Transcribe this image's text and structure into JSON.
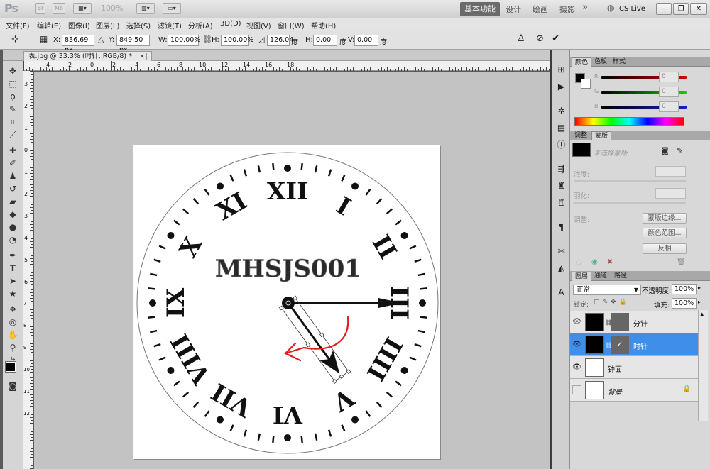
{
  "app": {
    "logo": "Ps",
    "zoom_level": "100%",
    "workspaces": [
      "基本功能",
      "设计",
      "绘画",
      "摄影"
    ],
    "more_workspaces": "»",
    "cs_live": "CS Live"
  },
  "menu": [
    "文件(F)",
    "编辑(E)",
    "图像(I)",
    "图层(L)",
    "选择(S)",
    "滤镜(T)",
    "分析(A)",
    "3D(D)",
    "视图(V)",
    "窗口(W)",
    "帮助(H)"
  ],
  "options": {
    "x_label": "X:",
    "x_value": "836.69 px",
    "y_label": "Y:",
    "y_value": "849.50 px",
    "w_label": "W:",
    "w_value": "100.00%",
    "h_label": "H:",
    "h_value": "100.00%",
    "rot_value": "126.04",
    "deg": "度",
    "hskew_label": "H:",
    "hskew_value": "0.00",
    "vskew_label": "V:",
    "vskew_value": "0.00"
  },
  "document": {
    "tab_title": "表.jpg @ 33.3% (时针, RGB/8) *",
    "clock_text": "MHSJS001"
  },
  "ruler": {
    "top": [
      "4",
      "2",
      "0",
      "2",
      "4",
      "6",
      "8",
      "10",
      "12",
      "14",
      "16",
      "18"
    ],
    "left": [
      "3",
      "2",
      "1",
      "0",
      "1",
      "2",
      "3",
      "4",
      "5",
      "6",
      "7",
      "8",
      "9",
      "10",
      "11",
      "12"
    ]
  },
  "color_panel": {
    "tabs": [
      "颜色",
      "色板",
      "样式"
    ],
    "channels": [
      {
        "label": "R",
        "value": "0"
      },
      {
        "label": "G",
        "value": "0"
      },
      {
        "label": "B",
        "value": "0"
      }
    ]
  },
  "mask_panel": {
    "tabs": [
      "调整",
      "蒙版"
    ],
    "no_mask": "未选择蒙版",
    "density": "浓度:",
    "feather": "羽化:",
    "refine": "调整:",
    "btn_edge": "蒙版边缘...",
    "btn_range": "颜色范围...",
    "btn_invert": "反相"
  },
  "layers_panel": {
    "tabs": [
      "图层",
      "通道",
      "路径"
    ],
    "blend_mode": "正常",
    "opacity_label": "不透明度:",
    "opacity_value": "100%",
    "lock_label": "锁定:",
    "fill_label": "填充:",
    "fill_value": "100%",
    "layers": [
      {
        "name": "分针",
        "selected": false
      },
      {
        "name": "时针",
        "selected": true
      },
      {
        "name": "钟面",
        "selected": false
      },
      {
        "name": "背景",
        "selected": false
      }
    ]
  },
  "colors": {
    "accent": "#3f8fe8",
    "red_arrow": "#e31b1b"
  }
}
